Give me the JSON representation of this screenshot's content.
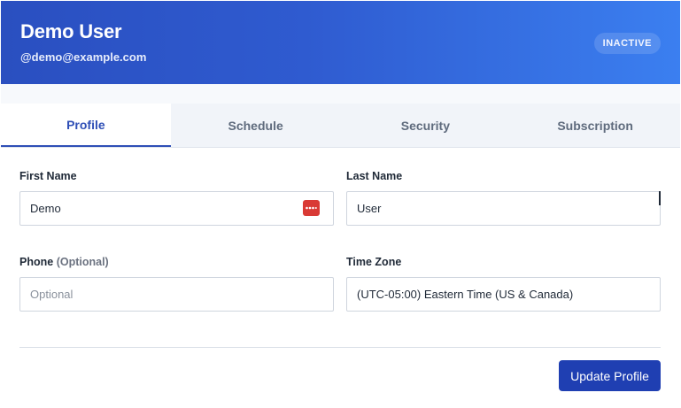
{
  "header": {
    "user_name": "Demo User",
    "user_email": "@demo@example.com",
    "status_badge": "INACTIVE"
  },
  "tabs": [
    {
      "label": "Profile",
      "active": true
    },
    {
      "label": "Schedule",
      "active": false
    },
    {
      "label": "Security",
      "active": false
    },
    {
      "label": "Subscription",
      "active": false
    }
  ],
  "form": {
    "first_name": {
      "label": "First Name",
      "value": "Demo",
      "icon": "password-manager-icon"
    },
    "last_name": {
      "label": "Last Name",
      "value": "User"
    },
    "phone": {
      "label": "Phone",
      "label_suffix": "(Optional)",
      "value": "",
      "placeholder": "Optional"
    },
    "time_zone": {
      "label": "Time Zone",
      "value": "(UTC-05:00) Eastern Time (US & Canada)"
    }
  },
  "actions": {
    "update_label": "Update Profile"
  },
  "colors": {
    "header_gradient_start": "#2a4fc0",
    "header_gradient_end": "#3b7ff0",
    "accent": "#2f4fb6",
    "primary_button": "#1f3fb2",
    "password_icon": "#d93a35"
  }
}
